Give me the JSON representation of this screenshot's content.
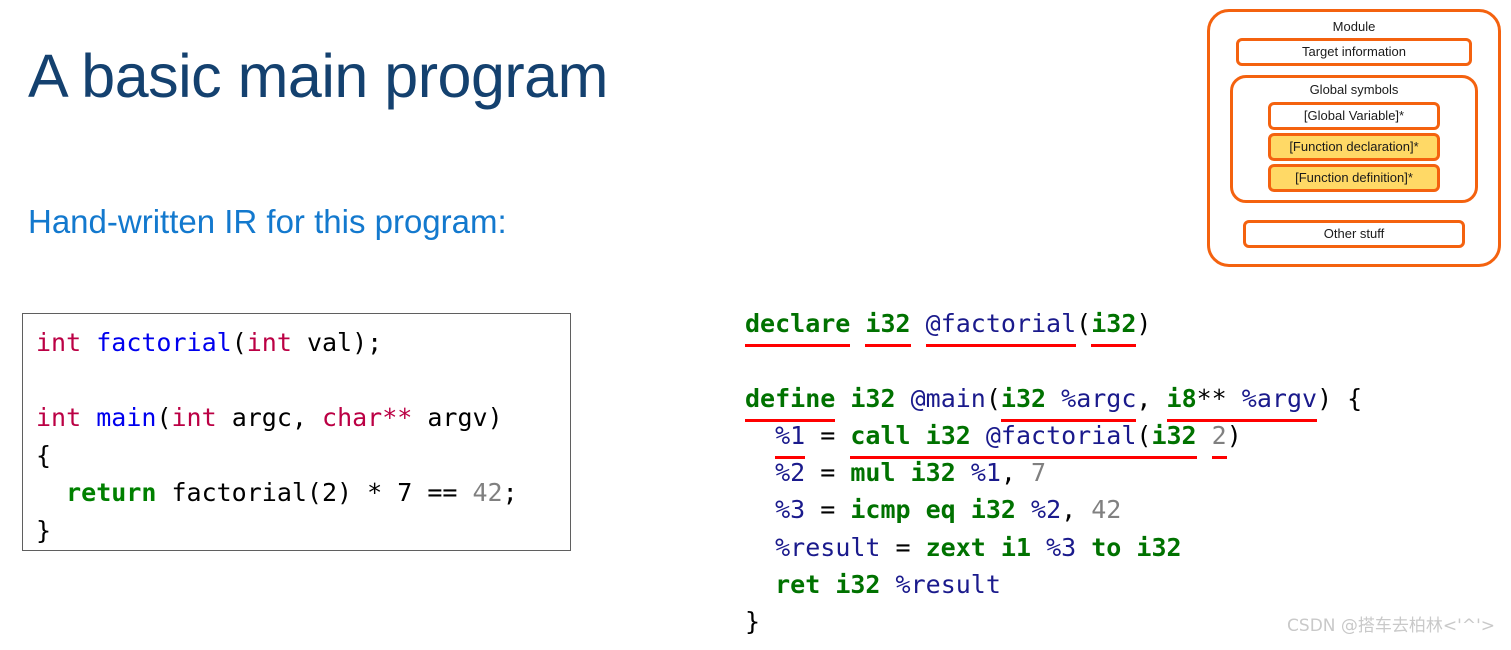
{
  "slide": {
    "title": "A basic main program",
    "subtitle": "Hand-written IR for this program:",
    "title_color": "#14416f",
    "subtitle_color": "#1379ce"
  },
  "c_code": {
    "language": "C",
    "lines": [
      "int factorial(int val);",
      "",
      "int main(int argc, char** argv)",
      "{",
      "  return factorial(2) * 7 == 42;",
      "}"
    ],
    "tokens": {
      "l1_int1": "int",
      "l1_space1": " ",
      "l1_fn": "factorial",
      "l1_paren_open": "(",
      "l1_int2": "int",
      "l1_param": " val);",
      "l3_int1": "int",
      "l3_space1": " ",
      "l3_fn": "main",
      "l3_paren_open": "(",
      "l3_int2": "int",
      "l3_argc": " argc, ",
      "l3_char": "char**",
      "l3_argv": " argv)",
      "l4_brace": "{",
      "l5_indent": "  ",
      "l5_return": "return",
      "l5_expr": " factorial(2) * 7 == ",
      "l5_num": "42",
      "l5_semi": ";",
      "l6_brace": "}"
    },
    "colors": {
      "type": "#bb0044",
      "function": "#0000ee",
      "keyword": "#008000",
      "number": "#808080",
      "plain": "#000000",
      "border": "#5f5f5f"
    }
  },
  "ir_code": {
    "language": "LLVM IR",
    "full_text": "declare i32 @factorial(i32)\n\ndefine i32 @main(i32 %argc, i8** %argv) {\n  %1 = call i32 @factorial(i32 2)\n  %2 = mul i32 %1, 7\n  %3 = icmp eq i32 %2, 42\n  %result = zext i1 %3 to i32\n  ret i32 %result\n}",
    "tokens": {
      "d1_declare": "declare",
      "d1_sp1": " ",
      "d1_i32a": "i32",
      "d1_sp2": " ",
      "d1_fn": "@factorial",
      "d1_open": "(",
      "d1_i32b": "i32",
      "d1_close": ")",
      "d2_define": "define",
      "d2_sp1": " ",
      "d2_i32": "i32",
      "d2_sp2": " ",
      "d2_fn": "@main",
      "d2_open": "(",
      "d2_arg1ty": "i32",
      "d2_arg1sp": " ",
      "d2_arg1": "%argc",
      "d2_comma": ", ",
      "d2_arg2ty": "i8",
      "d2_arg2stars": "**",
      "d2_arg2sp": " ",
      "d2_arg2": "%argv",
      "d2_close": ") {",
      "d3_indent": "  ",
      "d3_reg": "%1",
      "d3_eq": " = ",
      "d3_call": "call",
      "d3_sp1": " ",
      "d3_i32a": "i32",
      "d3_sp2": " ",
      "d3_fn": "@factorial",
      "d3_open": "(",
      "d3_i32b": "i32",
      "d3_sp3": " ",
      "d3_num": "2",
      "d3_close": ")",
      "d4_indent": "  ",
      "d4_reg": "%2",
      "d4_eq": " = ",
      "d4_mul": "mul",
      "d4_sp1": " ",
      "d4_i32": "i32",
      "d4_sp2": " ",
      "d4_op": "%1",
      "d4_comma": ", ",
      "d4_num": "7",
      "d5_indent": "  ",
      "d5_reg": "%3",
      "d5_eq": " = ",
      "d5_icmp": "icmp eq",
      "d5_sp1": " ",
      "d5_i32": "i32",
      "d5_sp2": " ",
      "d5_op": "%2",
      "d5_comma": ", ",
      "d5_num": "42",
      "d6_indent": "  ",
      "d6_reg": "%result",
      "d6_eq": " = ",
      "d6_zext": "zext",
      "d6_sp1": " ",
      "d6_i1": "i1",
      "d6_sp2": " ",
      "d6_op": "%3",
      "d6_sp3": " ",
      "d6_to": "to",
      "d6_sp4": " ",
      "d6_i32": "i32",
      "d7_indent": "  ",
      "d7_ret": "ret",
      "d7_sp1": " ",
      "d7_i32": "i32",
      "d7_sp2": " ",
      "d7_reg": "%result",
      "d8_brace": "}"
    },
    "colors": {
      "keyword": "#007200",
      "type": "#007200",
      "global": "#1a1a8c",
      "register": "#1a1a8c",
      "number": "#808080",
      "underline": "#ff0000"
    }
  },
  "module_diagram": {
    "module_label": "Module",
    "target_information": "Target information",
    "global_symbols_label": "Global symbols",
    "global_variable": "[Global Variable]*",
    "function_declaration": "[Function declaration]*",
    "function_definition": "[Function definition]*",
    "other_stuff": "Other stuff",
    "colors": {
      "border": "#f4620f",
      "highlight": "#ffd966",
      "background": "#ffffff"
    }
  },
  "watermark": {
    "text": "CSDN @搭车去柏林<'^'>",
    "color": "#c9c9c9"
  }
}
